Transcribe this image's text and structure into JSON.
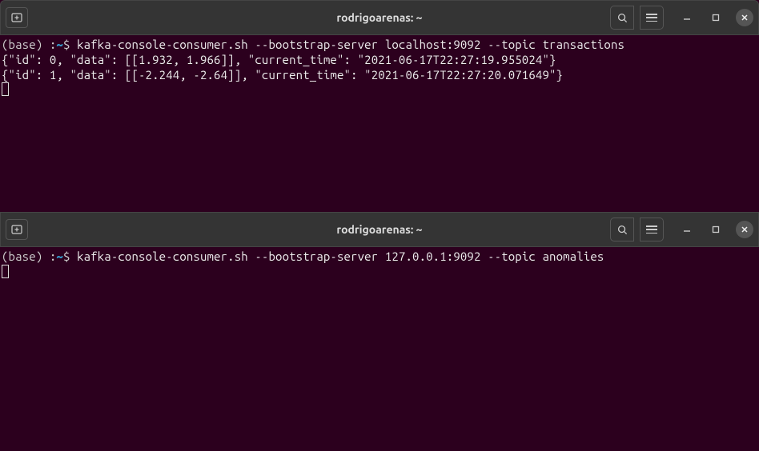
{
  "terminals": [
    {
      "title": "rodrigoarenas: ~",
      "prompt_base": "(base) :",
      "prompt_tilde": "~",
      "prompt_dollar": "$ ",
      "command": "kafka-console-consumer.sh --bootstrap-server localhost:9092 --topic transactions",
      "output_lines": [
        "{\"id\": 0, \"data\": [[1.932, 1.966]], \"current_time\": \"2021-06-17T22:27:19.955024\"}",
        "{\"id\": 1, \"data\": [[-2.244, -2.64]], \"current_time\": \"2021-06-17T22:27:20.071649\"}"
      ]
    },
    {
      "title": "rodrigoarenas: ~",
      "prompt_base": "(base) :",
      "prompt_tilde": "~",
      "prompt_dollar": "$ ",
      "command": "kafka-console-consumer.sh --bootstrap-server 127.0.0.1:9092 --topic anomalies",
      "output_lines": []
    }
  ]
}
